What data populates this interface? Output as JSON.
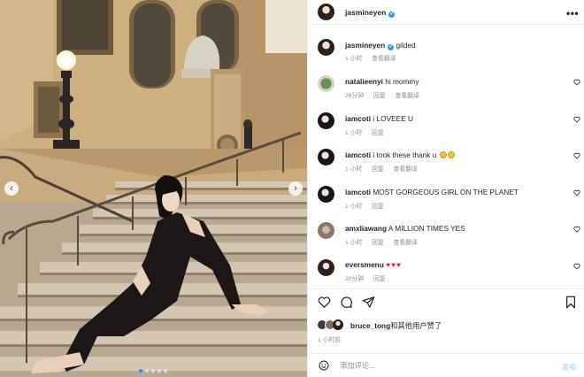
{
  "post": {
    "author": "jasmineyen",
    "verified": true,
    "caption": "gilded",
    "caption_time": "1 小时",
    "see_translation": "查看翻译",
    "carousel": {
      "current_slide": 1,
      "total_slides": 5
    }
  },
  "comments": [
    {
      "user": "natalieenyi",
      "text": "hi mommy",
      "time": "26分钟",
      "reply": "回复",
      "translate": "查看翻译"
    },
    {
      "user": "iamcoti",
      "text": "i LOVEEE U",
      "time": "1 小时",
      "reply": "回复"
    },
    {
      "user": "iamcoti",
      "text": "i took these thank u",
      "emoji_count": 2,
      "time": "1 小时",
      "reply": "回复",
      "translate": "查看翻译"
    },
    {
      "user": "iamcoti",
      "text": "MOST GORGEOUS GIRL ON THE PLANET",
      "time": "1 小时",
      "reply": "回复"
    },
    {
      "user": "amxliawang",
      "text": "A MILLION TIMES YES",
      "time": "1 小时",
      "reply": "回复",
      "translate": "查看翻译"
    },
    {
      "user": "eversmenu",
      "text": "♥♥♥",
      "time": "20分钟",
      "reply": "回复"
    }
  ],
  "likes": {
    "user": "bruce_tong",
    "text": "和其他用户赞了"
  },
  "post_time": "1 小时前",
  "comment_box": {
    "placeholder": "添加评论...",
    "post_label": "发布"
  },
  "icons": [
    "heart-icon",
    "comment-icon",
    "share-icon",
    "bookmark-icon",
    "more-icon",
    "emoji-icon",
    "chevron-left-icon",
    "chevron-right-icon"
  ],
  "colors": {
    "verified": "#3897f0",
    "heart_red": "#e0262d",
    "post_button": "#b2dffc",
    "muted": "#8e8e8e",
    "active_dot": "#2f8bf5"
  }
}
